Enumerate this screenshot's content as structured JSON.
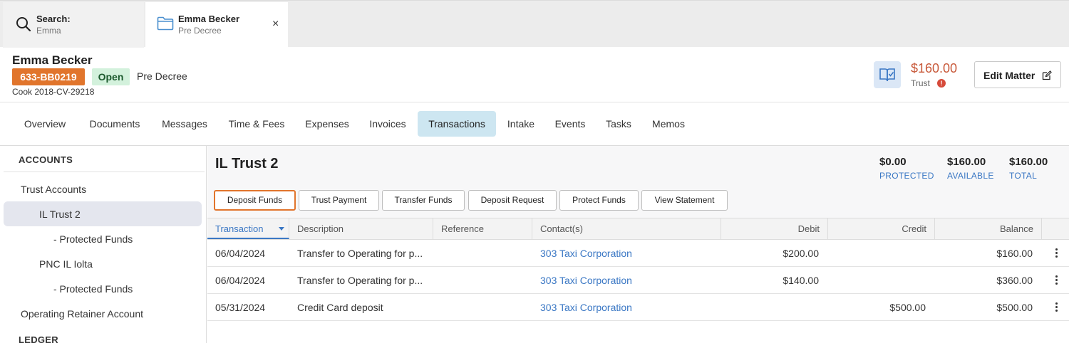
{
  "top_tabs": {
    "search": {
      "title": "Search:",
      "subtitle": "Emma"
    },
    "matter": {
      "title": "Emma Becker",
      "subtitle": "Pre Decree",
      "close_glyph": "×"
    }
  },
  "matter": {
    "name": "Emma Becker",
    "id_badge": "633-BB0219",
    "status": "Open",
    "stage": "Pre Decree",
    "case_number": "Cook 2018-CV-29218",
    "trust_amount": "$160.00",
    "trust_label": "Trust",
    "warning_glyph": "!",
    "edit_label": "Edit Matter"
  },
  "nav": {
    "tabs": [
      "Overview",
      "Documents",
      "Messages",
      "Time & Fees",
      "Expenses",
      "Invoices",
      "Transactions",
      "Intake",
      "Events",
      "Tasks",
      "Memos"
    ],
    "active": "Transactions"
  },
  "sidebar": {
    "accounts_heading": "ACCOUNTS",
    "items": [
      {
        "label": "Trust Accounts"
      },
      {
        "label": "IL Trust 2",
        "selected": true
      },
      {
        "label": "- Protected Funds"
      },
      {
        "label": "PNC IL Iolta"
      },
      {
        "label": "- Protected Funds"
      },
      {
        "label": "Operating Retainer Account"
      }
    ],
    "ledger_heading": "LEDGER"
  },
  "account": {
    "title": "IL Trust 2",
    "summary": [
      {
        "value": "$0.00",
        "label": "PROTECTED"
      },
      {
        "value": "$160.00",
        "label": "AVAILABLE"
      },
      {
        "value": "$160.00",
        "label": "TOTAL"
      }
    ],
    "actions": [
      "Deposit Funds",
      "Trust Payment",
      "Transfer Funds",
      "Deposit Request",
      "Protect Funds",
      "View Statement"
    ]
  },
  "table": {
    "columns": [
      "Transaction",
      "Description",
      "Reference",
      "Contact(s)",
      "Debit",
      "Credit",
      "Balance"
    ],
    "rows": [
      {
        "transaction": "06/04/2024",
        "description": "Transfer to Operating for p...",
        "reference": "",
        "contact": "303 Taxi Corporation",
        "debit": "$200.00",
        "credit": "",
        "balance": "$160.00"
      },
      {
        "transaction": "06/04/2024",
        "description": "Transfer to Operating for p...",
        "reference": "",
        "contact": "303 Taxi Corporation",
        "debit": "$140.00",
        "credit": "",
        "balance": "$360.00"
      },
      {
        "transaction": "05/31/2024",
        "description": "Credit Card deposit",
        "reference": "",
        "contact": "303 Taxi Corporation",
        "debit": "",
        "credit": "$500.00",
        "balance": "$500.00"
      }
    ]
  },
  "colors": {
    "accent_orange": "#e1752c",
    "status_green_bg": "#d3f1dc",
    "link_blue": "#3a77c4",
    "nav_active_bg": "#cde6f1",
    "trust_red": "#c8593a"
  }
}
